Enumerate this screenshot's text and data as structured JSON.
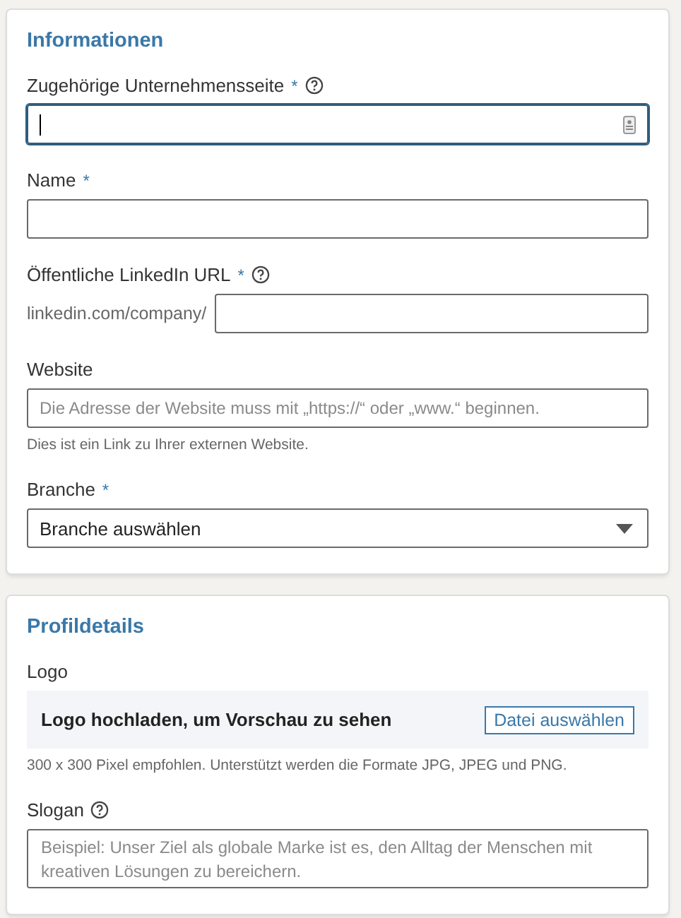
{
  "sections": [
    {
      "title": "Informationen",
      "fields": [
        {
          "kind": "text",
          "label": "Zugehörige Unternehmensseite",
          "required_mark": "*",
          "help": true,
          "focused": true,
          "autofill_icon": true
        },
        {
          "kind": "text",
          "label": "Name",
          "required_mark": "*"
        },
        {
          "kind": "prefixed",
          "label": "Öffentliche LinkedIn URL",
          "required_mark": "*",
          "help": true,
          "prefix": "linkedin.com/company/"
        },
        {
          "kind": "text",
          "label": "Website",
          "placeholder": "Die Adresse der Website muss mit „https://“ oder „www.“ beginnen.",
          "hint": "Dies ist ein Link zu Ihrer externen Website."
        },
        {
          "kind": "select",
          "label": "Branche",
          "required_mark": "*",
          "value": "Branche auswählen"
        }
      ]
    },
    {
      "title": "Profildetails",
      "fields": [
        {
          "kind": "upload",
          "label": "Logo",
          "message": "Logo hochladen, um Vorschau zu sehen",
          "button": "Datei auswählen",
          "hint": "300 x 300 Pixel empfohlen. Unterstützt werden die Formate JPG, JPEG und PNG."
        },
        {
          "kind": "textarea",
          "label": "Slogan",
          "help": true,
          "placeholder": "Beispiel: Unser Ziel als globale Marke ist es, den Alltag der Menschen mit kreativen Lösungen zu bereichern."
        }
      ]
    }
  ]
}
